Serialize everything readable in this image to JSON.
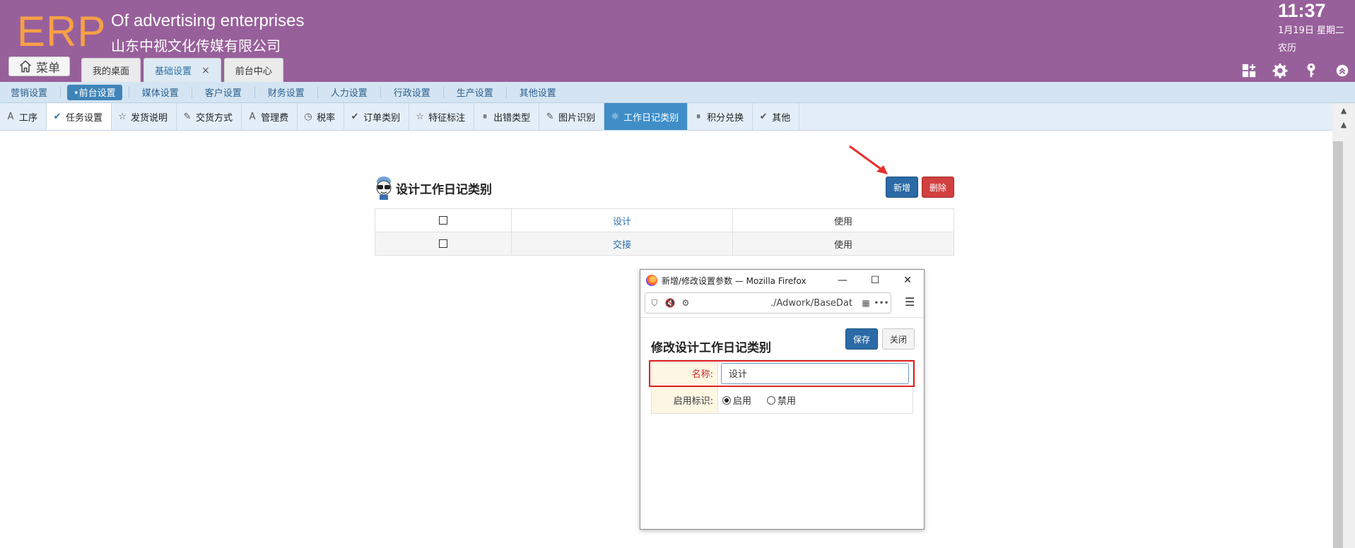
{
  "header": {
    "logo": "ERP",
    "company_en": "Of advertising enterprises",
    "company_cn": "山东中视文化传媒有限公司",
    "clock_time": "11:37",
    "clock_date": "1月19日 星期二",
    "clock_lunar": "农历",
    "menu_label": "菜单",
    "tabs": [
      {
        "label": "我的桌面"
      },
      {
        "label": "基础设置",
        "close": "×"
      },
      {
        "label": "前台中心"
      }
    ],
    "icons": [
      "app-add-icon",
      "gear-icon",
      "key-icon",
      "collapse-icon"
    ]
  },
  "nav2": {
    "items": [
      "营销设置",
      "•前台设置",
      "媒体设置",
      "客户设置",
      "财务设置",
      "人力设置",
      "行政设置",
      "生产设置",
      "其他设置"
    ],
    "active": 1
  },
  "nav3": {
    "items": [
      {
        "label": "工序",
        "icon": "A"
      },
      {
        "label": "任务设置",
        "icon": "✔"
      },
      {
        "label": "发货说明",
        "icon": "☆"
      },
      {
        "label": "交货方式",
        "icon": "✎"
      },
      {
        "label": "管理费",
        "icon": "A"
      },
      {
        "label": "税率",
        "icon": "◷"
      },
      {
        "label": "订单类别",
        "icon": "✔"
      },
      {
        "label": "特征标注",
        "icon": "☆"
      },
      {
        "label": "出错类型",
        "icon": "⏸"
      },
      {
        "label": "图片识别",
        "icon": "✎"
      },
      {
        "label": "工作日记类别",
        "icon": "☼"
      },
      {
        "label": "积分兑换",
        "icon": "⏸"
      },
      {
        "label": "其他",
        "icon": "✔"
      }
    ],
    "active": 10,
    "selected": 1
  },
  "panel": {
    "title": "设计工作日记类别",
    "add_label": "新增",
    "delete_label": "删除",
    "rows": [
      {
        "name": "设计",
        "status": "使用"
      },
      {
        "name": "交接",
        "status": "使用"
      }
    ]
  },
  "popup": {
    "window_title": "新增/修改设置参数 — Mozilla Firefox",
    "url": "./Adwork/BaseDat",
    "form_title": "修改设计工作日记类别",
    "save_label": "保存",
    "close_label": "关闭",
    "name_label": "名称:",
    "name_value": "设计",
    "enable_label": "启用标识:",
    "opt_enable": "启用",
    "opt_disable": "禁用"
  }
}
